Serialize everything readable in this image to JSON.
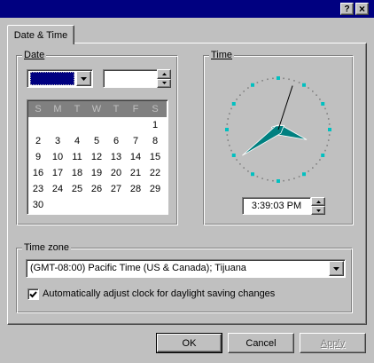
{
  "window": {
    "title": "",
    "help_glyph": "?",
    "close_glyph": "×",
    "title_bar_color": "#000080"
  },
  "tabs": [
    {
      "label": "Date & Time",
      "active": true
    }
  ],
  "date_group": {
    "label": "Date",
    "month_value": "",
    "year_value": "",
    "calendar": {
      "weekdays": [
        "S",
        "M",
        "T",
        "W",
        "T",
        "F",
        "S"
      ],
      "first_weekday_index": 6,
      "days": [
        1,
        2,
        3,
        4,
        5,
        6,
        7,
        8,
        9,
        10,
        11,
        12,
        13,
        14,
        15,
        16,
        17,
        18,
        19,
        20,
        21,
        22,
        23,
        24,
        25,
        26,
        27,
        28,
        29,
        30
      ]
    }
  },
  "time_group": {
    "label": "Time",
    "clock": {
      "hours": 3,
      "minutes": 39,
      "seconds": 3
    },
    "time_value": "3:39:03 PM"
  },
  "timezone_group": {
    "label": "Time zone",
    "selected": "(GMT-08:00) Pacific Time (US & Canada); Tijuana",
    "dst_checkbox_label": "Automatically adjust clock for daylight saving changes",
    "dst_checked": true
  },
  "buttons": {
    "ok": "OK",
    "cancel": "Cancel",
    "apply": "Apply"
  },
  "icons": {
    "dropdown": "triangle-down",
    "spin_up": "triangle-up",
    "spin_down": "triangle-down",
    "check": "checkmark"
  },
  "colors": {
    "face": "#c0c0c0",
    "highlight": "#000080",
    "clock_hands": "#008080",
    "clock_ticks": "#00c0c0"
  }
}
